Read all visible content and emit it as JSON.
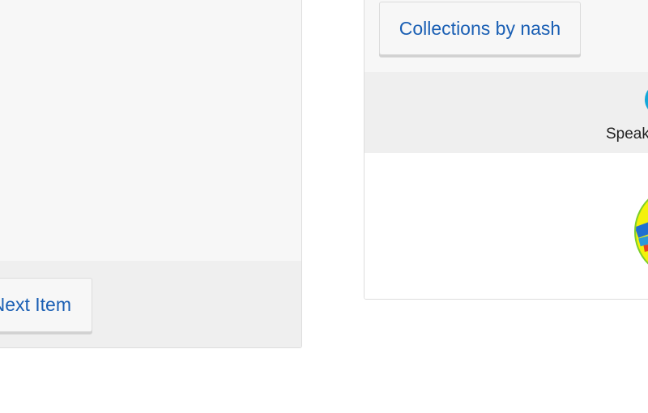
{
  "left_panel": {
    "next_item_label": "Next Item"
  },
  "right_panel": {
    "collections_label": "Collections by nash",
    "speaker_label": "Speak",
    "speaker_avatar_color": "#14a7d8",
    "collection_image_colors": {
      "base": "#f4f20a",
      "ring": "#7dcf2a",
      "stripe_blue": "#1f6fd1",
      "stripe_light_blue": "#2a9ad9",
      "stripe_red": "#e8431f"
    }
  },
  "colors": {
    "link_blue": "#1a5fb4",
    "panel_bg": "#f7f7f7",
    "band_bg": "#efefef",
    "border": "#dddddd"
  }
}
